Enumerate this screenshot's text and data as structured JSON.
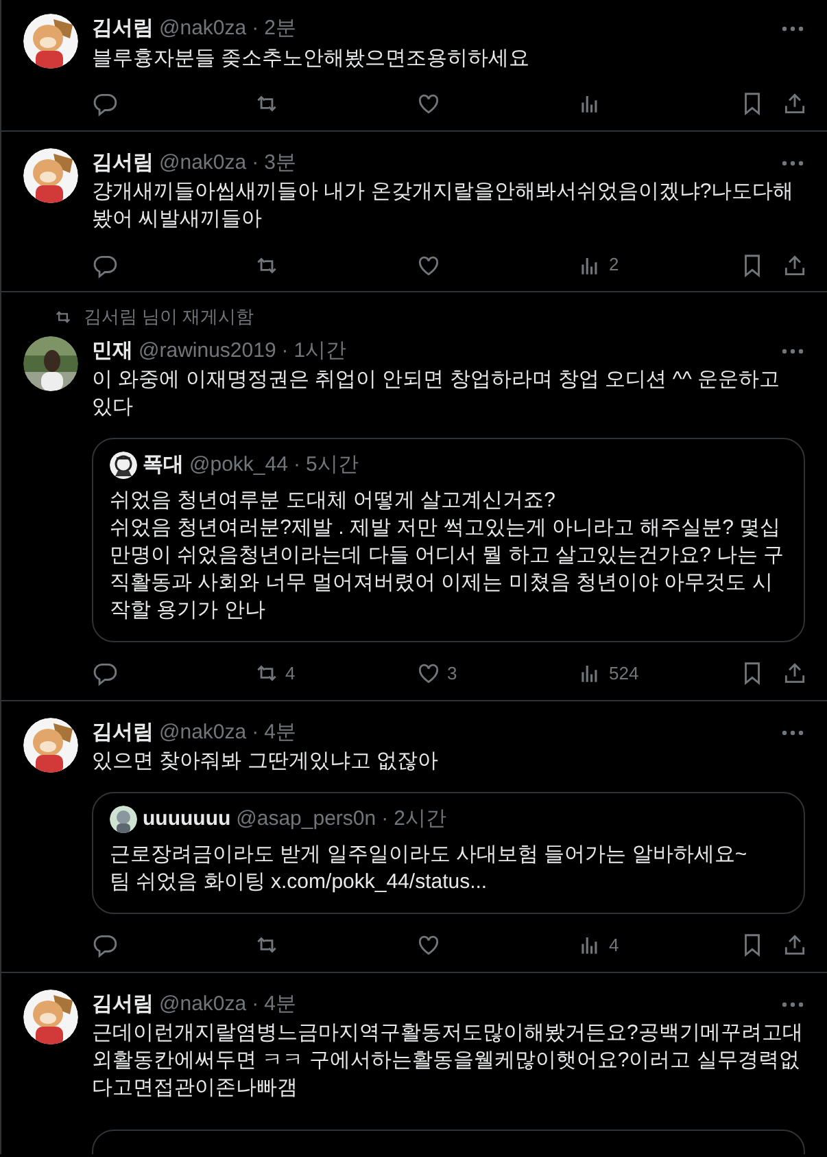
{
  "tweets": [
    {
      "name": "김서림",
      "handle": "@nak0za",
      "separator": "·",
      "time": "2분",
      "text": "블루흉자분들 좆소추노안해봤으면조용히하세요"
    },
    {
      "name": "김서림",
      "handle": "@nak0za",
      "separator": "·",
      "time": "3분",
      "text": "걍개새끼들아씹새끼들아 내가 온갖개지랄을안해봐서쉬었음이겠냐?나도다해봤어 씨발새끼들아",
      "stats": {
        "views": "2"
      }
    },
    {
      "repost": "김서림 님이 재게시함",
      "name": "민재",
      "handle": "@rawinus2019",
      "separator": "·",
      "time": "1시간",
      "text": "이 와중에 이재명정권은 취업이 안되면 창업하라며 창업 오디션 ^^ 운운하고 있다",
      "quote": {
        "name": "폭대",
        "handle": "@pokk_44",
        "separator": "·",
        "time": "5시간",
        "text": "쉬었음 청년여루분 도대체 어떻게 살고계신거죠?\n쉬었음 청년여러분?제발 . 제발 저만 썩고있는게 아니라고 해주실분? 몇십만명이 쉬었음청년이라는데 다들 어디서 뭘 하고 살고있는건가요? 나는 구직활동과 사회와 너무 멀어져버렸어 이제는 미쳤음 청년이야 아무것도 시작할 용기가 안나"
      },
      "stats": {
        "reposts": "4",
        "likes": "3",
        "views": "524"
      }
    },
    {
      "name": "김서림",
      "handle": "@nak0za",
      "separator": "·",
      "time": "4분",
      "text": "있으면 찾아줘봐 그딴게있냐고 없잖아",
      "quote": {
        "name": "uuuuuuu",
        "handle": "@asap_pers0n",
        "separator": "·",
        "time": "2시간",
        "text": "근로장려금이라도 받게 일주일이라도 사대보험 들어가는 알바하세요~\n팀 쉬었음 화이팅",
        "link": "x.com/pokk_44/status..."
      },
      "stats": {
        "views": "4"
      }
    },
    {
      "name": "김서림",
      "handle": "@nak0za",
      "separator": "·",
      "time": "4분",
      "text": "근데이런개지랄염병느금마지역구활동저도많이해봤거든요?공백기메꾸려고대외활동칸에써두면 ㅋㅋ 구에서하는활동을웰케많이햇어요?이러고 실무경력없다고면접관이존나빠갬",
      "quote": {
        "kind": "clipped"
      }
    }
  ]
}
